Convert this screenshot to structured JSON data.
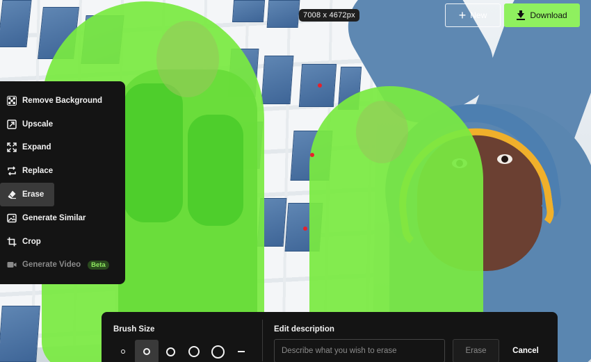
{
  "image_info": {
    "dimensions": "7008 x 4672px"
  },
  "header": {
    "new_label": "New",
    "download_label": "Download"
  },
  "tools": [
    {
      "label": "Remove Background",
      "icon": "checker-icon",
      "state": "normal"
    },
    {
      "label": "Upscale",
      "icon": "upscale-icon",
      "state": "normal"
    },
    {
      "label": "Expand",
      "icon": "expand-icon",
      "state": "normal"
    },
    {
      "label": "Replace",
      "icon": "replace-icon",
      "state": "normal"
    },
    {
      "label": "Erase",
      "icon": "eraser-icon",
      "state": "active"
    },
    {
      "label": "Generate Similar",
      "icon": "image-icon",
      "state": "normal"
    },
    {
      "label": "Crop",
      "icon": "crop-icon",
      "state": "normal"
    },
    {
      "label": "Generate Video",
      "icon": "video-icon",
      "state": "disabled",
      "badge": "Beta"
    }
  ],
  "erase_panel": {
    "brush_size_label": "Brush Size",
    "brush_sizes": [
      "xs",
      "s",
      "m",
      "l",
      "xl"
    ],
    "selected_brush": "s",
    "edit_description_label": "Edit description",
    "description_placeholder": "Describe what you wish to erase",
    "description_value": "",
    "erase_label": "Erase",
    "cancel_label": "Cancel"
  },
  "colors": {
    "accent": "#8ff05f",
    "mask": "#7aea42",
    "panel_bg": "#141414",
    "active_item": "#3a3a3a",
    "marker": "#e8202a"
  }
}
